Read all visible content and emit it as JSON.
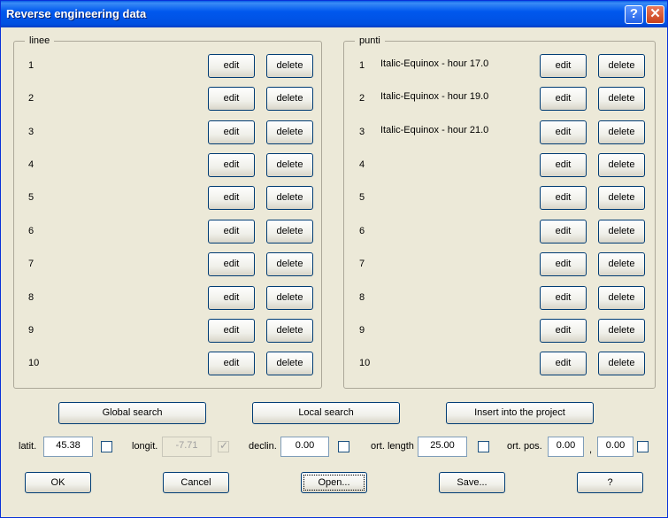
{
  "window": {
    "title": "Reverse engineering data",
    "help_glyph": "?",
    "close_glyph": "✕"
  },
  "left_group": {
    "title": "linee",
    "rows": [
      {
        "num": "1",
        "text": "",
        "edit": "edit",
        "delete": "delete"
      },
      {
        "num": "2",
        "text": "",
        "edit": "edit",
        "delete": "delete"
      },
      {
        "num": "3",
        "text": "",
        "edit": "edit",
        "delete": "delete"
      },
      {
        "num": "4",
        "text": "",
        "edit": "edit",
        "delete": "delete"
      },
      {
        "num": "5",
        "text": "",
        "edit": "edit",
        "delete": "delete"
      },
      {
        "num": "6",
        "text": "",
        "edit": "edit",
        "delete": "delete"
      },
      {
        "num": "7",
        "text": "",
        "edit": "edit",
        "delete": "delete"
      },
      {
        "num": "8",
        "text": "",
        "edit": "edit",
        "delete": "delete"
      },
      {
        "num": "9",
        "text": "",
        "edit": "edit",
        "delete": "delete"
      },
      {
        "num": "10",
        "text": "",
        "edit": "edit",
        "delete": "delete"
      }
    ]
  },
  "right_group": {
    "title": "punti",
    "rows": [
      {
        "num": "1",
        "text": "Italic-Equinox - hour 17.0",
        "edit": "edit",
        "delete": "delete"
      },
      {
        "num": "2",
        "text": "Italic-Equinox - hour 19.0",
        "edit": "edit",
        "delete": "delete"
      },
      {
        "num": "3",
        "text": "Italic-Equinox - hour 21.0",
        "edit": "edit",
        "delete": "delete"
      },
      {
        "num": "4",
        "text": "",
        "edit": "edit",
        "delete": "delete"
      },
      {
        "num": "5",
        "text": "",
        "edit": "edit",
        "delete": "delete"
      },
      {
        "num": "6",
        "text": "",
        "edit": "edit",
        "delete": "delete"
      },
      {
        "num": "7",
        "text": "",
        "edit": "edit",
        "delete": "delete"
      },
      {
        "num": "8",
        "text": "",
        "edit": "edit",
        "delete": "delete"
      },
      {
        "num": "9",
        "text": "",
        "edit": "edit",
        "delete": "delete"
      },
      {
        "num": "10",
        "text": "",
        "edit": "edit",
        "delete": "delete"
      }
    ]
  },
  "search": {
    "global": "Global search",
    "local": "Local search",
    "insert": "Insert into the project"
  },
  "params": {
    "latit_label": "latit.",
    "latit_value": "45.38",
    "longit_label": "longit.",
    "longit_value": "-7.71",
    "declin_label": "declin.",
    "declin_value": "0.00",
    "ort_length_label": "ort. length",
    "ort_length_value": "25.00",
    "ort_pos_label": "ort. pos.",
    "ort_pos_value1": "0.00",
    "ort_pos_sep": ",",
    "ort_pos_value2": "0.00"
  },
  "footer": {
    "ok": "OK",
    "cancel": "Cancel",
    "open": "Open...",
    "save": "Save...",
    "help": "?"
  }
}
